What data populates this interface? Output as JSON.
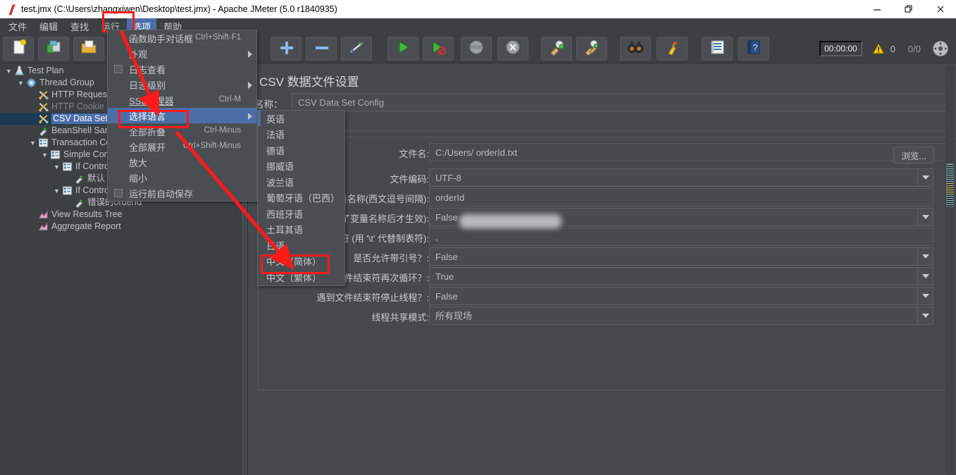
{
  "window": {
    "title": "test.jmx (C:\\Users\\zhangxiwen\\Desktop\\test.jmx) - Apache JMeter (5.0 r1840935)",
    "app_icon": "jmeter-feather-icon",
    "minimize": "minimize-icon",
    "maximize": "maximize-icon",
    "close": "close-icon"
  },
  "menubar": {
    "items": [
      {
        "label": "文件",
        "active": false
      },
      {
        "label": "编辑",
        "active": false
      },
      {
        "label": "查找",
        "active": false
      },
      {
        "label": "运行",
        "active": false
      },
      {
        "label": "选项",
        "active": true
      },
      {
        "label": "帮助",
        "active": false
      }
    ]
  },
  "options_menu": {
    "items": [
      {
        "label": "函数助手对话框",
        "accel": "Ctrl+Shift-F1",
        "checkbox": false,
        "submenu": false,
        "selected": false,
        "underline": false
      },
      {
        "label": "外观",
        "accel": "",
        "checkbox": false,
        "submenu": true,
        "selected": false,
        "underline": false
      },
      {
        "label": "日志查看",
        "accel": "",
        "checkbox": true,
        "submenu": false,
        "selected": false,
        "underline": false
      },
      {
        "label": "日志级别",
        "accel": "",
        "checkbox": false,
        "submenu": true,
        "selected": false,
        "underline": false
      },
      {
        "label": "SSL管理器",
        "accel": "Ctrl-M",
        "checkbox": false,
        "submenu": false,
        "selected": false,
        "underline": true
      },
      {
        "label": "选择语言",
        "accel": "",
        "checkbox": false,
        "submenu": true,
        "selected": true,
        "underline": false
      },
      {
        "label": "全部折叠",
        "accel": "Ctrl-Minus",
        "checkbox": false,
        "submenu": false,
        "selected": false,
        "underline": false
      },
      {
        "label": "全部展开",
        "accel": "Ctrl+Shift-Minus",
        "checkbox": false,
        "submenu": false,
        "selected": false,
        "underline": false
      },
      {
        "label": "放大",
        "accel": "",
        "checkbox": false,
        "submenu": false,
        "selected": false,
        "underline": false
      },
      {
        "label": "缩小",
        "accel": "",
        "checkbox": false,
        "submenu": false,
        "selected": false,
        "underline": false
      },
      {
        "label": "运行前自动保存",
        "accel": "",
        "checkbox": true,
        "submenu": false,
        "selected": false,
        "underline": false
      }
    ]
  },
  "language_menu": {
    "items": [
      {
        "label": "英语"
      },
      {
        "label": "法语"
      },
      {
        "label": "德语"
      },
      {
        "label": "挪威语"
      },
      {
        "label": "波兰语"
      },
      {
        "label": "葡萄牙语（巴西）"
      },
      {
        "label": "西班牙语"
      },
      {
        "label": "土耳其语"
      },
      {
        "label": "日语"
      },
      {
        "label": "中文（简体）"
      },
      {
        "label": "中文（繁体）"
      }
    ],
    "highlighted": "中文（简体）"
  },
  "toolbar": {
    "buttons": [
      {
        "name": "new-button",
        "icon": "new-document-icon"
      },
      {
        "name": "templates-button",
        "icon": "templates-icon"
      },
      {
        "name": "open-button",
        "icon": "open-folder-icon"
      },
      {
        "name": "add-button",
        "icon": "plus-icon"
      },
      {
        "name": "remove-button",
        "icon": "minus-icon"
      },
      {
        "name": "toggle-button",
        "icon": "toggle-icon"
      },
      {
        "name": "start-button",
        "icon": "play-icon"
      },
      {
        "name": "start-no-pauses-button",
        "icon": "play-no-pause-icon"
      },
      {
        "name": "stop-button",
        "icon": "stop-icon"
      },
      {
        "name": "shutdown-button",
        "icon": "shutdown-icon"
      },
      {
        "name": "clear-button",
        "icon": "clear-broom-icon"
      },
      {
        "name": "clear-all-button",
        "icon": "clear-all-broom-icon"
      },
      {
        "name": "search-button",
        "icon": "binoculars-icon"
      },
      {
        "name": "reset-search-button",
        "icon": "broom-icon"
      },
      {
        "name": "function-helper-button",
        "icon": "list-icon"
      },
      {
        "name": "help-button",
        "icon": "help-book-icon"
      }
    ],
    "timer": "00:00:00",
    "warning_icon": "warning-triangle-icon",
    "warning_count": "0",
    "thread_count": "0/0",
    "expand_icon": "expand-icon"
  },
  "tree": {
    "nodes": [
      {
        "label": "Test Plan",
        "indent": 0,
        "toggle": "open",
        "icon": "test-plan-icon",
        "selected": false,
        "dim": false
      },
      {
        "label": "Thread Group",
        "indent": 1,
        "toggle": "open",
        "icon": "thread-group-icon",
        "selected": false,
        "dim": false
      },
      {
        "label": "HTTP Request De",
        "indent": 2,
        "toggle": "none",
        "icon": "config-tools-icon",
        "selected": false,
        "dim": false
      },
      {
        "label": "HTTP Cookie Man",
        "indent": 2,
        "toggle": "none",
        "icon": "config-tools-icon",
        "selected": false,
        "dim": true
      },
      {
        "label": "CSV Data Set Con",
        "indent": 2,
        "toggle": "none",
        "icon": "config-tools-icon",
        "selected": true,
        "dim": false
      },
      {
        "label": "BeanShell Sample",
        "indent": 2,
        "toggle": "none",
        "icon": "sampler-pipette-icon",
        "selected": false,
        "dim": false
      },
      {
        "label": "Transaction Contr",
        "indent": 2,
        "toggle": "open",
        "icon": "controller-icon",
        "selected": false,
        "dim": false
      },
      {
        "label": "Simple Controlle",
        "indent": 3,
        "toggle": "open",
        "icon": "controller-icon",
        "selected": false,
        "dim": false
      },
      {
        "label": "If Controller",
        "indent": 4,
        "toggle": "open",
        "icon": "controller-icon",
        "selected": false,
        "dim": false
      },
      {
        "label": "默认",
        "indent": 5,
        "toggle": "none",
        "icon": "sampler-pipette-icon",
        "selected": false,
        "dim": false
      },
      {
        "label": "If Controller",
        "indent": 4,
        "toggle": "open",
        "icon": "controller-icon",
        "selected": false,
        "dim": false
      },
      {
        "label": "错误的orderId",
        "indent": 5,
        "toggle": "none",
        "icon": "sampler-pipette-icon",
        "selected": false,
        "dim": false
      },
      {
        "label": "View Results Tree",
        "indent": 2,
        "toggle": "none",
        "icon": "listener-icon",
        "selected": false,
        "dim": false
      },
      {
        "label": "Aggregate Report",
        "indent": 2,
        "toggle": "none",
        "icon": "listener-icon",
        "selected": false,
        "dim": false
      }
    ]
  },
  "panel": {
    "title": "CSV 数据文件设置",
    "name_label": "名称：",
    "name_value": "CSV Data Set Config",
    "comment_value": "",
    "browse_label": "浏览...",
    "fields": [
      {
        "label": "文件名:",
        "value": "C:/Users/                     orderId.txt",
        "type": "text-redacted"
      },
      {
        "label": "文件编码:",
        "value": "UTF-8",
        "type": "combo"
      },
      {
        "label": "变量名称(西文逗号间隔):",
        "value": "orderId",
        "type": "text"
      },
      {
        "label": "忽略首行(只在设置了变量名称后才生效):",
        "value": "False",
        "type": "combo"
      },
      {
        "label": "分隔符 (用 '\\t' 代替制表符):",
        "value": ",",
        "type": "text"
      },
      {
        "label": "是否允许带引号？:",
        "value": "False",
        "type": "combo"
      },
      {
        "label": "遇到文件结束符再次循环？:",
        "value": "True",
        "type": "combo"
      },
      {
        "label": "遇到文件结束符停止线程？:",
        "value": "False",
        "type": "combo"
      },
      {
        "label": "线程共享模式:",
        "value": "所有现场",
        "type": "combo"
      }
    ]
  },
  "annotations": {
    "boxes": [
      "options-menu-item",
      "select-language-item",
      "chinese-simplified-item"
    ],
    "arrows": 2,
    "color": "#ff1a1a"
  }
}
